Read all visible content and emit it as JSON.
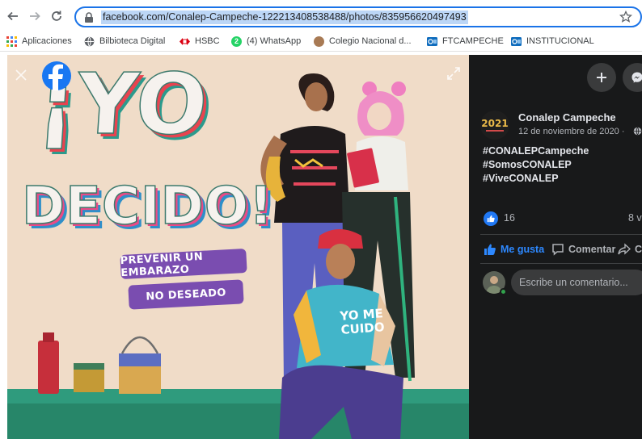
{
  "browser": {
    "back_icon": "arrow-left-icon",
    "forward_icon": "arrow-right-icon",
    "reload_icon": "reload-icon",
    "url": "facebook.com/Conalep-Campeche-122213408538488/photos/835956620497493",
    "accent_color": "#1a73e8"
  },
  "bookmarks": [
    {
      "label": "Aplicaciones",
      "icon": "apps-grid-icon"
    },
    {
      "label": "Bilbioteca Digital",
      "icon": "globe-icon"
    },
    {
      "label": "HSBC",
      "icon": "hsbc-logo-icon"
    },
    {
      "label": "(4) WhatsApp",
      "icon": "whatsapp-icon"
    },
    {
      "label": "Colegio Nacional d...",
      "icon": "site-icon"
    },
    {
      "label": "FTCAMPECHE",
      "icon": "outlook-icon"
    },
    {
      "label": "INSTITUCIONAL",
      "icon": "outlook-icon"
    }
  ],
  "photo": {
    "headline_line1": "¡YO",
    "headline_line2": "DECIDO!",
    "banner_line1": "PREVENIR UN EMBARAZO",
    "banner_line2": "NO DESEADO",
    "shirt_text_line1": "YO ME",
    "shirt_text_line2": "CUIDO",
    "background_color": "#f0dcc8",
    "banner_color": "#7a4db0"
  },
  "post": {
    "page_name": "Conalep Campeche",
    "page_avatar_text": "2021",
    "date": "12 de noviembre de 2020 ·",
    "hashtags": [
      "#CONALEPCampeche",
      "#SomosCONALEP",
      "#ViveCONALEP"
    ],
    "like_count": "16",
    "shares_text": "8 v",
    "actions": {
      "like": "Me gusta",
      "comment": "Comentar",
      "share": "C"
    },
    "comment_placeholder": "Escribe un comentario...",
    "like_color": "#2078f4",
    "background_color": "#18191a"
  }
}
